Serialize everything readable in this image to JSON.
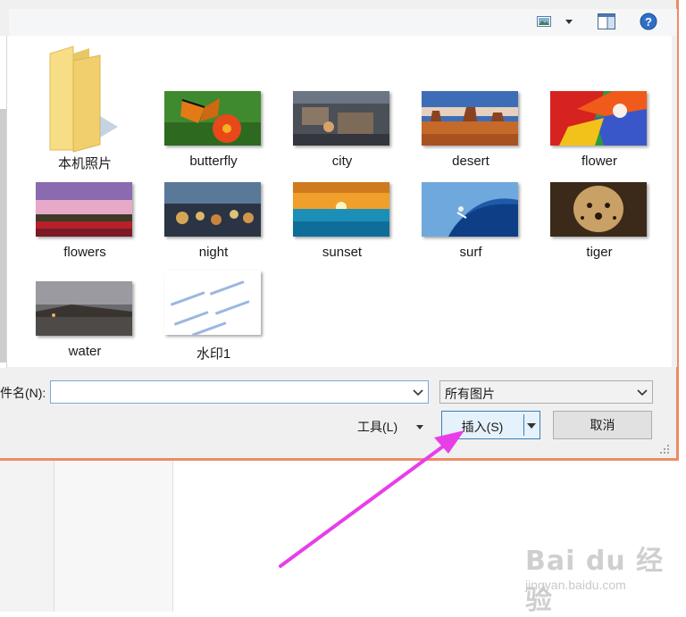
{
  "toolbar": {
    "view_icon": "view-thumbnails-icon",
    "view_menu_icon": "chevron-down-icon",
    "preview_pane_icon": "preview-pane-icon",
    "help_icon": "help-icon"
  },
  "files": [
    {
      "label": "本机照片",
      "type": "folder"
    },
    {
      "label": "butterfly",
      "type": "image"
    },
    {
      "label": "city",
      "type": "image"
    },
    {
      "label": "desert",
      "type": "image"
    },
    {
      "label": "flower",
      "type": "image"
    },
    {
      "label": "flowers",
      "type": "image"
    },
    {
      "label": "night",
      "type": "image"
    },
    {
      "label": "sunset",
      "type": "image"
    },
    {
      "label": "surf",
      "type": "image"
    },
    {
      "label": "tiger",
      "type": "image"
    },
    {
      "label": "water",
      "type": "image"
    },
    {
      "label": "水印1",
      "type": "image"
    }
  ],
  "bottom": {
    "filename_label": "件名(N):",
    "filename_value": "",
    "filter_value": "所有图片",
    "tools_label": "工具(L)",
    "insert_label": "插入(S)",
    "cancel_label": "取消"
  },
  "watermark": {
    "logo": "Bai du 经验",
    "url": "jingyan.baidu.com"
  },
  "colors": {
    "dialog_border": "#f08a64",
    "arrow": "#e83ee8",
    "insert_border": "#3c7fb1"
  }
}
